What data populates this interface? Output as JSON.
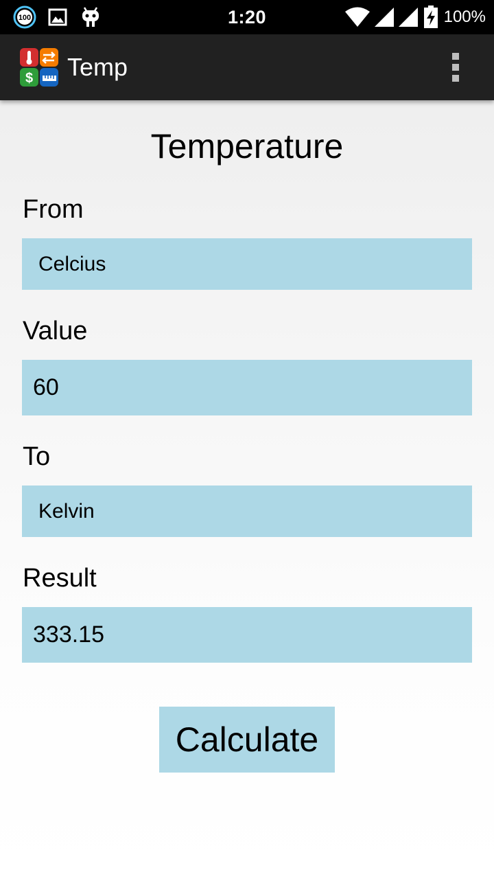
{
  "status_bar": {
    "time": "1:20",
    "battery_percent": "100%",
    "notification_badge": "100",
    "icons": [
      "badge-100-icon",
      "image-icon",
      "android-robot-icon",
      "wifi-icon",
      "signal-icon",
      "signal-icon",
      "battery-charging-icon"
    ]
  },
  "action_bar": {
    "title": "Temp",
    "logo_icon": "converter-app-icon",
    "menu_icon": "overflow-menu-icon"
  },
  "form": {
    "heading": "Temperature",
    "from_label": "From",
    "from_value": "Celcius",
    "value_label": "Value",
    "value_value": "60",
    "to_label": "To",
    "to_value": "Kelvin",
    "result_label": "Result",
    "result_value": "333.15",
    "calculate_label": "Calculate"
  },
  "colors": {
    "field_background": "#add8e6",
    "action_bar": "#212121",
    "status_bar": "#000000"
  }
}
